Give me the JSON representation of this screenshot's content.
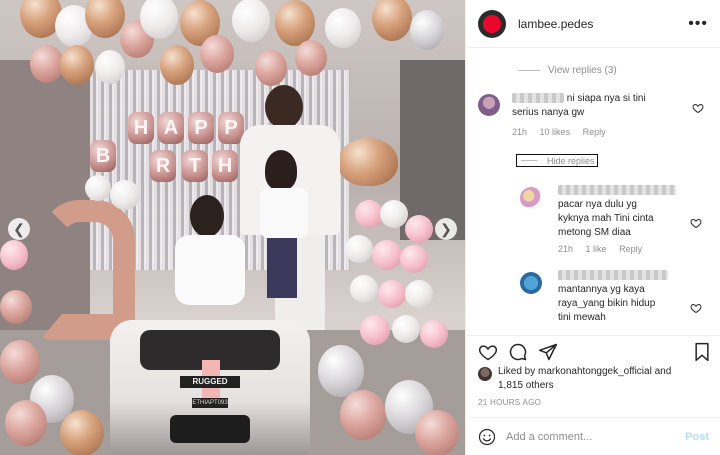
{
  "photo": {
    "letters": [
      "H",
      "A",
      "P",
      "P",
      "B",
      "R",
      "T",
      "H"
    ],
    "car_brand": "RUGGED",
    "car_plate": "ETHIAPT093",
    "prev_icon": "chevron-left-icon",
    "next_icon": "chevron-right-icon",
    "prev_glyph": "❮",
    "next_glyph": "❯"
  },
  "header": {
    "username": "lambee.pedes",
    "more_glyph": "•••",
    "more_icon": "more-icon"
  },
  "comments": {
    "view_replies": "View replies (3)",
    "hide_replies": "Hide replies",
    "items": [
      {
        "text_line1": "ni siapa nya si tini",
        "text_line2": "serius nanya gw",
        "time": "21h",
        "likes": "10 likes",
        "reply": "Reply"
      },
      {
        "text_line1": "pacar nya dulu yg",
        "text_line2": "kyknya mah Tini cinta",
        "text_line3": "metong SM diaa",
        "time": "21h",
        "likes": "1 like",
        "reply": "Reply"
      },
      {
        "text_line1": "mantannya yg kaya",
        "text_line2": "raya_yang bikin hidup",
        "text_line3": "tini mewah"
      }
    ]
  },
  "actions": {
    "icons": [
      "heart-icon",
      "comment-icon",
      "share-icon",
      "bookmark-icon"
    ]
  },
  "likes": {
    "prefix": "Liked by ",
    "user": "markonahtonggek_official",
    "and": " and",
    "others": "1,815 others"
  },
  "time_ago": "21 HOURS AGO",
  "add_comment": {
    "placeholder": "Add a comment...",
    "post_label": "Post"
  },
  "colors": {
    "accent_post_disabled": "#b2dffc",
    "text": "#262626",
    "muted": "#8e8e8e",
    "brand_red": "#e9062b"
  }
}
